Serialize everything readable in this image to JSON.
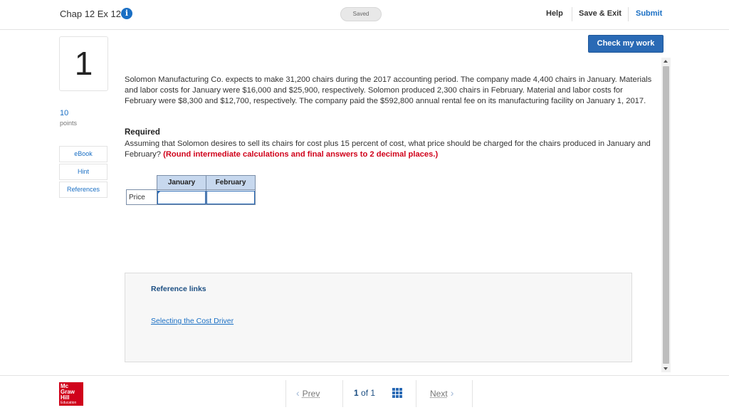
{
  "header": {
    "title": "Chap 12 Ex 12",
    "info_icon": "i",
    "saved_label": "Saved",
    "help_label": "Help",
    "save_exit_label": "Save & Exit",
    "submit_label": "Submit"
  },
  "sidebar": {
    "question_number": "1",
    "points_value": "10",
    "points_label": "points",
    "ebook_label": "eBook",
    "hint_label": "Hint",
    "references_label": "References"
  },
  "main": {
    "check_label": "Check my work",
    "question_text": "Solomon Manufacturing Co. expects to make 31,200 chairs during the 2017 accounting period. The company made 4,400 chairs in January. Materials and labor costs for January were $16,000 and $25,900, respectively. Solomon produced 2,300 chairs in February. Material and labor costs for February were $8,300 and $12,700, respectively. The company paid the $592,800 annual rental fee on its manufacturing facility on January 1, 2017.",
    "required_heading": "Required",
    "required_text": "Assuming that Solomon desires to sell its chairs for cost plus 15 percent of cost, what price should be charged for the chairs produced in January and February?",
    "required_instruction": "(Round intermediate calculations and final answers to 2 decimal places.)",
    "table": {
      "columns": [
        "January",
        "February"
      ],
      "row_label": "Price",
      "values": [
        "",
        ""
      ]
    },
    "reference": {
      "title": "Reference links",
      "link": "Selecting the Cost Driver"
    }
  },
  "footer": {
    "logo_lines": [
      "Mc",
      "Graw",
      "Hill",
      "Education"
    ],
    "prev_label": "Prev",
    "page_current": "1",
    "page_of": "of",
    "page_total": "1",
    "next_label": "Next"
  },
  "colors": {
    "accent": "#1a6fc4",
    "button": "#2a6ab5",
    "instruction_red": "#d0021b",
    "logo_red": "#d0021b"
  },
  "icons": [
    "info-icon",
    "grid-icon",
    "chevron-left-icon",
    "chevron-right-icon"
  ]
}
